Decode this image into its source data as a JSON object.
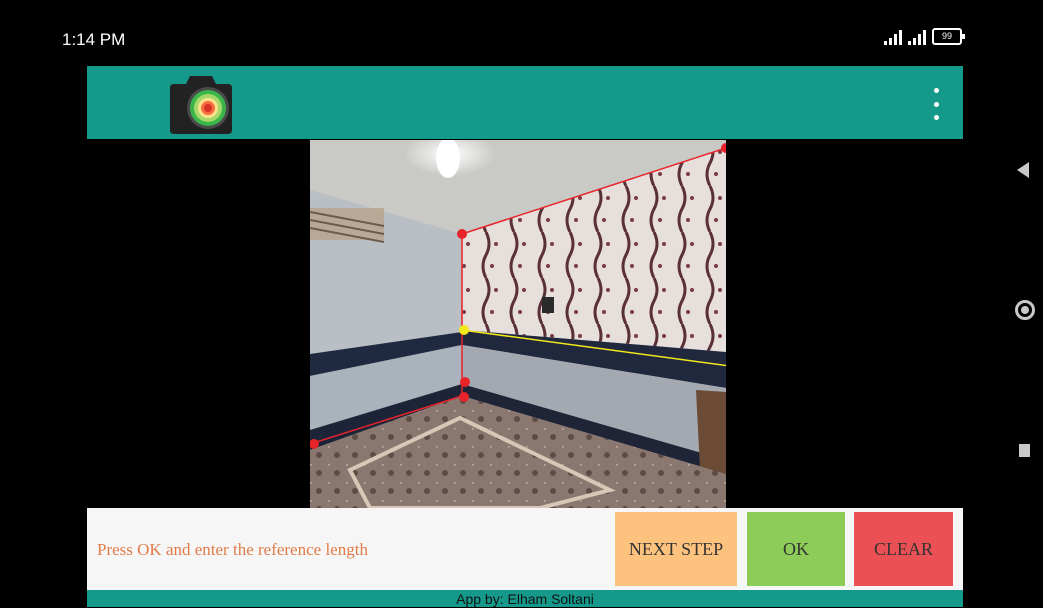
{
  "status_bar": {
    "time": "1:14 PM",
    "battery": "99"
  },
  "app_bar": {
    "logo_icon": "camera-heatmap-icon",
    "menu_icon": "overflow-menu-icon"
  },
  "photo": {
    "description_icon": "room-photo"
  },
  "bottom_panel": {
    "instruction": "Press OK and enter the reference length",
    "next_step_label": "NEXT STEP",
    "ok_label": "OK",
    "clear_label": "CLEAR"
  },
  "footer": {
    "credit": "App by: Elham Soltani"
  },
  "colors": {
    "app_bar": "#14998a",
    "instruction_text": "#e07b48",
    "next_step": "#fdc37e",
    "ok": "#8dcc59",
    "clear": "#ea5054",
    "marker_red": "#e8242a",
    "marker_yellow": "#f2e81c"
  }
}
